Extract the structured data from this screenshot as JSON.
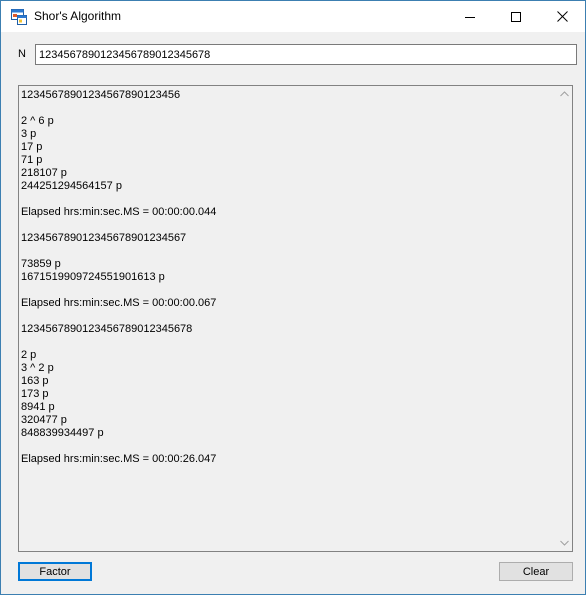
{
  "window": {
    "title": "Shor's Algorithm"
  },
  "input": {
    "label": "N",
    "value": "1234567890123456789012345678"
  },
  "output": {
    "lines": [
      "12345678901234567890123456",
      "",
      "2 ^ 6 p",
      "3 p",
      "17 p",
      "71 p",
      "218107 p",
      "244251294564157 p",
      "",
      "Elapsed hrs:min:sec.MS = 00:00:00.044",
      "",
      "123456789012345678901234567",
      "",
      "73859 p",
      "1671519909724551901613 p",
      "",
      "Elapsed hrs:min:sec.MS = 00:00:00.067",
      "",
      "1234567890123456789012345678",
      "",
      "2 p",
      "3 ^ 2 p",
      "163 p",
      "173 p",
      "8941 p",
      "320477 p",
      "848839934497 p",
      "",
      "Elapsed hrs:min:sec.MS = 00:00:26.047"
    ]
  },
  "buttons": {
    "factor_label": "Factor",
    "clear_label": "Clear"
  },
  "icons": {
    "app": "app-form-icon",
    "minimize": "minimize-icon",
    "maximize": "maximize-icon",
    "close": "close-icon",
    "scroll_up": "chevron-up-icon",
    "scroll_down": "chevron-down-icon"
  },
  "colors": {
    "accent": "#0078d7",
    "window_border": "#3c7fb1",
    "background": "#f0f0f0"
  }
}
